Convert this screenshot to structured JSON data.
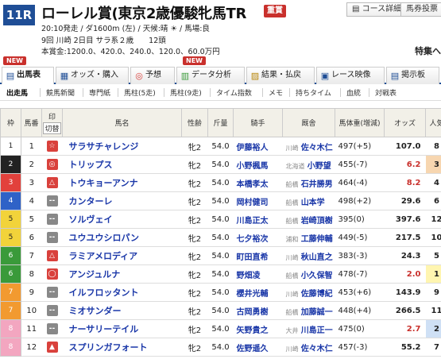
{
  "header": {
    "race_no": "11R",
    "race_name": "ローレル賞(東京2歳優駿牝馬TR",
    "grade": "重賞",
    "course_detail_btn": "コース詳細",
    "horse_memo_btn": "馬券投票",
    "line1": "20:10発走 / ダ1600m (左) / 天候:晴 ☀ / 馬場:良",
    "line2": "9回 川崎 2日目 サラ系２歳　　12頭",
    "line3": "本賞金:1200.0、420.0、240.0、120.0、60.0万円",
    "tokushu": "特集へ",
    "new_label": "NEW"
  },
  "tabs": [
    {
      "label": "出馬表",
      "icon": "list-icon"
    },
    {
      "label": "オッズ・購入",
      "icon": "odds-icon"
    },
    {
      "label": "予想",
      "icon": "target-icon"
    },
    {
      "label": "データ分析",
      "icon": "chart-icon"
    },
    {
      "label": "結果・払戻",
      "icon": "result-icon"
    },
    {
      "label": "レース映像",
      "icon": "video-icon"
    },
    {
      "label": "掲示板",
      "icon": "board-icon"
    }
  ],
  "subtabs": [
    "出走馬",
    "競馬新聞",
    "専門紙",
    "馬柱(5走)",
    "馬柱(9走)",
    "タイム指数",
    "メモ",
    "持ちタイム",
    "血統",
    "対戦表"
  ],
  "table": {
    "headers": {
      "waku": "枠",
      "umaban": "馬番",
      "mark_top": "印",
      "mark_bottom": "切替",
      "horse": "馬名",
      "sexage": "性齢",
      "kinryo": "斤量",
      "jockey": "騎手",
      "trainer": "厩舎",
      "weight": "馬体重(増減)",
      "odds": "オッズ",
      "ninki": "人気"
    },
    "rows": [
      {
        "waku": "1",
        "umaban": "1",
        "mark": "☆",
        "horse": "サラサチャレンジ",
        "sexage": "牝2",
        "kinryo": "54.0",
        "jockey": "伊藤裕人",
        "area": "川崎",
        "trainer": "佐々木仁",
        "weight": "497(+5)",
        "odds": "107.0",
        "ninki": "8"
      },
      {
        "waku": "2",
        "umaban": "2",
        "mark": "◎",
        "horse": "トリップス",
        "sexage": "牝2",
        "kinryo": "54.0",
        "jockey": "小野楓馬",
        "area": "北海道",
        "trainer": "小野望",
        "weight": "455(-7)",
        "odds": "6.2",
        "ninki": "3"
      },
      {
        "waku": "3",
        "umaban": "3",
        "mark": "△",
        "horse": "トウキョーアンナ",
        "sexage": "牝2",
        "kinryo": "54.0",
        "jockey": "本橋孝太",
        "area": "船橋",
        "trainer": "石井勝男",
        "weight": "464(-4)",
        "odds": "8.2",
        "ninki": "4"
      },
      {
        "waku": "4",
        "umaban": "4",
        "mark": "--",
        "horse": "カンターレ",
        "sexage": "牝2",
        "kinryo": "54.0",
        "jockey": "岡村健司",
        "area": "船橋",
        "trainer": "山本学",
        "weight": "498(+2)",
        "odds": "29.6",
        "ninki": "6"
      },
      {
        "waku": "5",
        "umaban": "5",
        "mark": "--",
        "horse": "ソルヴェイ",
        "sexage": "牝2",
        "kinryo": "54.0",
        "jockey": "川島正太",
        "area": "船橋",
        "trainer": "岩崎頂樹",
        "weight": "395(0)",
        "odds": "397.6",
        "ninki": "12"
      },
      {
        "waku": "5",
        "umaban": "6",
        "mark": "--",
        "horse": "ユウユウシロパン",
        "sexage": "牝2",
        "kinryo": "54.0",
        "jockey": "七夕裕次",
        "area": "浦和",
        "trainer": "工藤伸輔",
        "weight": "449(-5)",
        "odds": "217.5",
        "ninki": "10"
      },
      {
        "waku": "6",
        "umaban": "7",
        "mark": "△",
        "horse": "ラミアメロディア",
        "sexage": "牝2",
        "kinryo": "54.0",
        "jockey": "町田直希",
        "area": "川崎",
        "trainer": "秋山直之",
        "weight": "383(-3)",
        "odds": "24.3",
        "ninki": "5"
      },
      {
        "waku": "6",
        "umaban": "8",
        "mark": "◯",
        "horse": "アンジュルナ",
        "sexage": "牝2",
        "kinryo": "54.0",
        "jockey": "野畑凌",
        "area": "船橋",
        "trainer": "小久保智",
        "weight": "478(-7)",
        "odds": "2.0",
        "ninki": "1"
      },
      {
        "waku": "7",
        "umaban": "9",
        "mark": "--",
        "horse": "イルフロッタント",
        "sexage": "牝2",
        "kinryo": "54.0",
        "jockey": "櫻井光輔",
        "area": "川崎",
        "trainer": "佐藤博紀",
        "weight": "453(+6)",
        "odds": "143.9",
        "ninki": "9"
      },
      {
        "waku": "7",
        "umaban": "10",
        "mark": "--",
        "horse": "ミオサンダー",
        "sexage": "牝2",
        "kinryo": "54.0",
        "jockey": "古岡勇樹",
        "area": "船橋",
        "trainer": "加藤誠一",
        "weight": "448(+4)",
        "odds": "266.5",
        "ninki": "11"
      },
      {
        "waku": "8",
        "umaban": "11",
        "mark": "--",
        "horse": "ナーサリーテイル",
        "sexage": "牝2",
        "kinryo": "54.0",
        "jockey": "矢野貴之",
        "area": "大井",
        "trainer": "川島正一",
        "weight": "475(0)",
        "odds": "2.7",
        "ninki": "2"
      },
      {
        "waku": "8",
        "umaban": "12",
        "mark": "▲",
        "horse": "スプリンガフォート",
        "sexage": "牝2",
        "kinryo": "54.0",
        "jockey": "佐野遥久",
        "area": "川崎",
        "trainer": "佐々木仁",
        "weight": "457(-3)",
        "odds": "55.2",
        "ninki": "7"
      }
    ]
  },
  "colors": {
    "waku": {
      "1": "#ffffff",
      "2": "#222222",
      "3": "#e2413c",
      "4": "#2f62c7",
      "5": "#f2d33a",
      "6": "#3a9a3a",
      "7": "#f29a30",
      "8": "#f3a6c0"
    },
    "waku_text": {
      "1": "#222222",
      "2": "#ffffff",
      "3": "#ffffff",
      "4": "#ffffff",
      "5": "#222222",
      "6": "#ffffff",
      "7": "#ffffff",
      "8": "#ffffff"
    },
    "accent": "#1f4e96",
    "odds_popular": "#c9302c"
  }
}
